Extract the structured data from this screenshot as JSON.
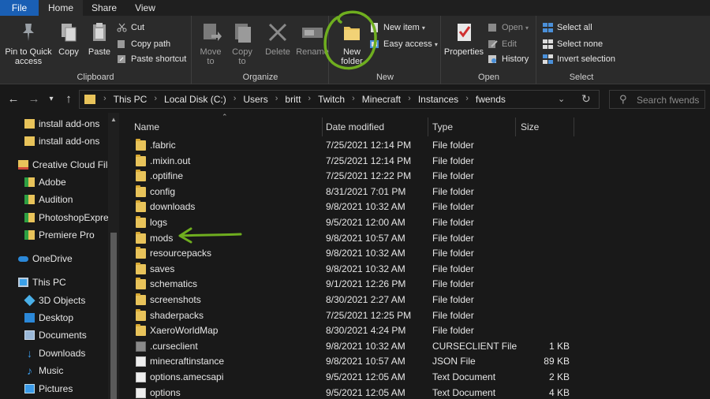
{
  "tabs": [
    {
      "label": "File"
    },
    {
      "label": "Home"
    },
    {
      "label": "Share"
    },
    {
      "label": "View"
    }
  ],
  "ribbon": {
    "clipboard": {
      "label": "Clipboard",
      "pin": "Pin to Quick access",
      "pin_l1": "Pin to Quick",
      "pin_l2": "access",
      "copy": "Copy",
      "paste": "Paste",
      "cut": "Cut",
      "copy_path": "Copy path",
      "paste_shortcut": "Paste shortcut"
    },
    "organize": {
      "label": "Organize",
      "move_l1": "Move",
      "move_l2": "to",
      "copy_l1": "Copy",
      "copy_l2": "to",
      "delete": "Delete",
      "rename": "Rename"
    },
    "new": {
      "label": "New",
      "new_folder_l1": "New",
      "new_folder_l2": "folder",
      "new_item": "New item",
      "easy_access": "Easy access"
    },
    "open": {
      "label": "Open",
      "properties": "Properties",
      "open": "Open",
      "edit": "Edit",
      "history": "History"
    },
    "select": {
      "label": "Select",
      "select_all": "Select all",
      "select_none": "Select none",
      "invert": "Invert selection"
    }
  },
  "address": {
    "crumbs": [
      "This PC",
      "Local Disk (C:)",
      "Users",
      "britt",
      "Twitch",
      "Minecraft",
      "Instances",
      "fwends"
    ],
    "search_placeholder": "Search fwends"
  },
  "navpane": {
    "items": [
      {
        "label": "install add-ons",
        "icon": "folder-icon"
      },
      {
        "label": "install add-ons",
        "icon": "folder-icon"
      },
      {
        "label": "Creative Cloud File",
        "icon": "creative-cloud-icon"
      },
      {
        "label": "Adobe",
        "icon": "synced-folder-icon"
      },
      {
        "label": "Audition",
        "icon": "synced-folder-icon"
      },
      {
        "label": "PhotoshopExpres",
        "icon": "synced-folder-icon"
      },
      {
        "label": "Premiere Pro",
        "icon": "synced-folder-icon"
      },
      {
        "label": "OneDrive",
        "icon": "onedrive-icon"
      },
      {
        "label": "This PC",
        "icon": "computer-icon"
      },
      {
        "label": "3D Objects",
        "icon": "3d-objects-icon"
      },
      {
        "label": "Desktop",
        "icon": "desktop-icon"
      },
      {
        "label": "Documents",
        "icon": "documents-icon"
      },
      {
        "label": "Downloads",
        "icon": "downloads-icon"
      },
      {
        "label": "Music",
        "icon": "music-icon"
      },
      {
        "label": "Pictures",
        "icon": "pictures-icon"
      }
    ]
  },
  "filelist": {
    "columns": {
      "name": "Name",
      "date": "Date modified",
      "type": "Type",
      "size": "Size"
    },
    "rows": [
      {
        "name": ".fabric",
        "date": "7/25/2021 12:14 PM",
        "type": "File folder",
        "size": "",
        "icon": "folder"
      },
      {
        "name": ".mixin.out",
        "date": "7/25/2021 12:14 PM",
        "type": "File folder",
        "size": "",
        "icon": "folder"
      },
      {
        "name": ".optifine",
        "date": "7/25/2021 12:22 PM",
        "type": "File folder",
        "size": "",
        "icon": "folder"
      },
      {
        "name": "config",
        "date": "8/31/2021 7:01 PM",
        "type": "File folder",
        "size": "",
        "icon": "folder"
      },
      {
        "name": "downloads",
        "date": "9/8/2021 10:32 AM",
        "type": "File folder",
        "size": "",
        "icon": "folder"
      },
      {
        "name": "logs",
        "date": "9/5/2021 12:00 AM",
        "type": "File folder",
        "size": "",
        "icon": "folder"
      },
      {
        "name": "mods",
        "date": "9/8/2021 10:57 AM",
        "type": "File folder",
        "size": "",
        "icon": "folder"
      },
      {
        "name": "resourcepacks",
        "date": "9/8/2021 10:32 AM",
        "type": "File folder",
        "size": "",
        "icon": "folder"
      },
      {
        "name": "saves",
        "date": "9/8/2021 10:32 AM",
        "type": "File folder",
        "size": "",
        "icon": "folder"
      },
      {
        "name": "schematics",
        "date": "9/1/2021 12:26 PM",
        "type": "File folder",
        "size": "",
        "icon": "folder"
      },
      {
        "name": "screenshots",
        "date": "8/30/2021 2:27 AM",
        "type": "File folder",
        "size": "",
        "icon": "folder"
      },
      {
        "name": "shaderpacks",
        "date": "7/25/2021 12:25 PM",
        "type": "File folder",
        "size": "",
        "icon": "folder"
      },
      {
        "name": "XaeroWorldMap",
        "date": "8/30/2021 4:24 PM",
        "type": "File folder",
        "size": "",
        "icon": "folder"
      },
      {
        "name": ".curseclient",
        "date": "9/8/2021 10:32 AM",
        "type": "CURSECLIENT File",
        "size": "1 KB",
        "icon": "file-gray"
      },
      {
        "name": "minecraftinstance",
        "date": "9/8/2021 10:57 AM",
        "type": "JSON File",
        "size": "89 KB",
        "icon": "json"
      },
      {
        "name": "options.amecsapi",
        "date": "9/5/2021 12:05 AM",
        "type": "Text Document",
        "size": "2 KB",
        "icon": "text"
      },
      {
        "name": "options",
        "date": "9/5/2021 12:05 AM",
        "type": "Text Document",
        "size": "4 KB",
        "icon": "text"
      }
    ]
  },
  "colors": {
    "accent": "#1a5fb4",
    "annotation": "#6fae1f",
    "folder": "#e8c35a"
  }
}
